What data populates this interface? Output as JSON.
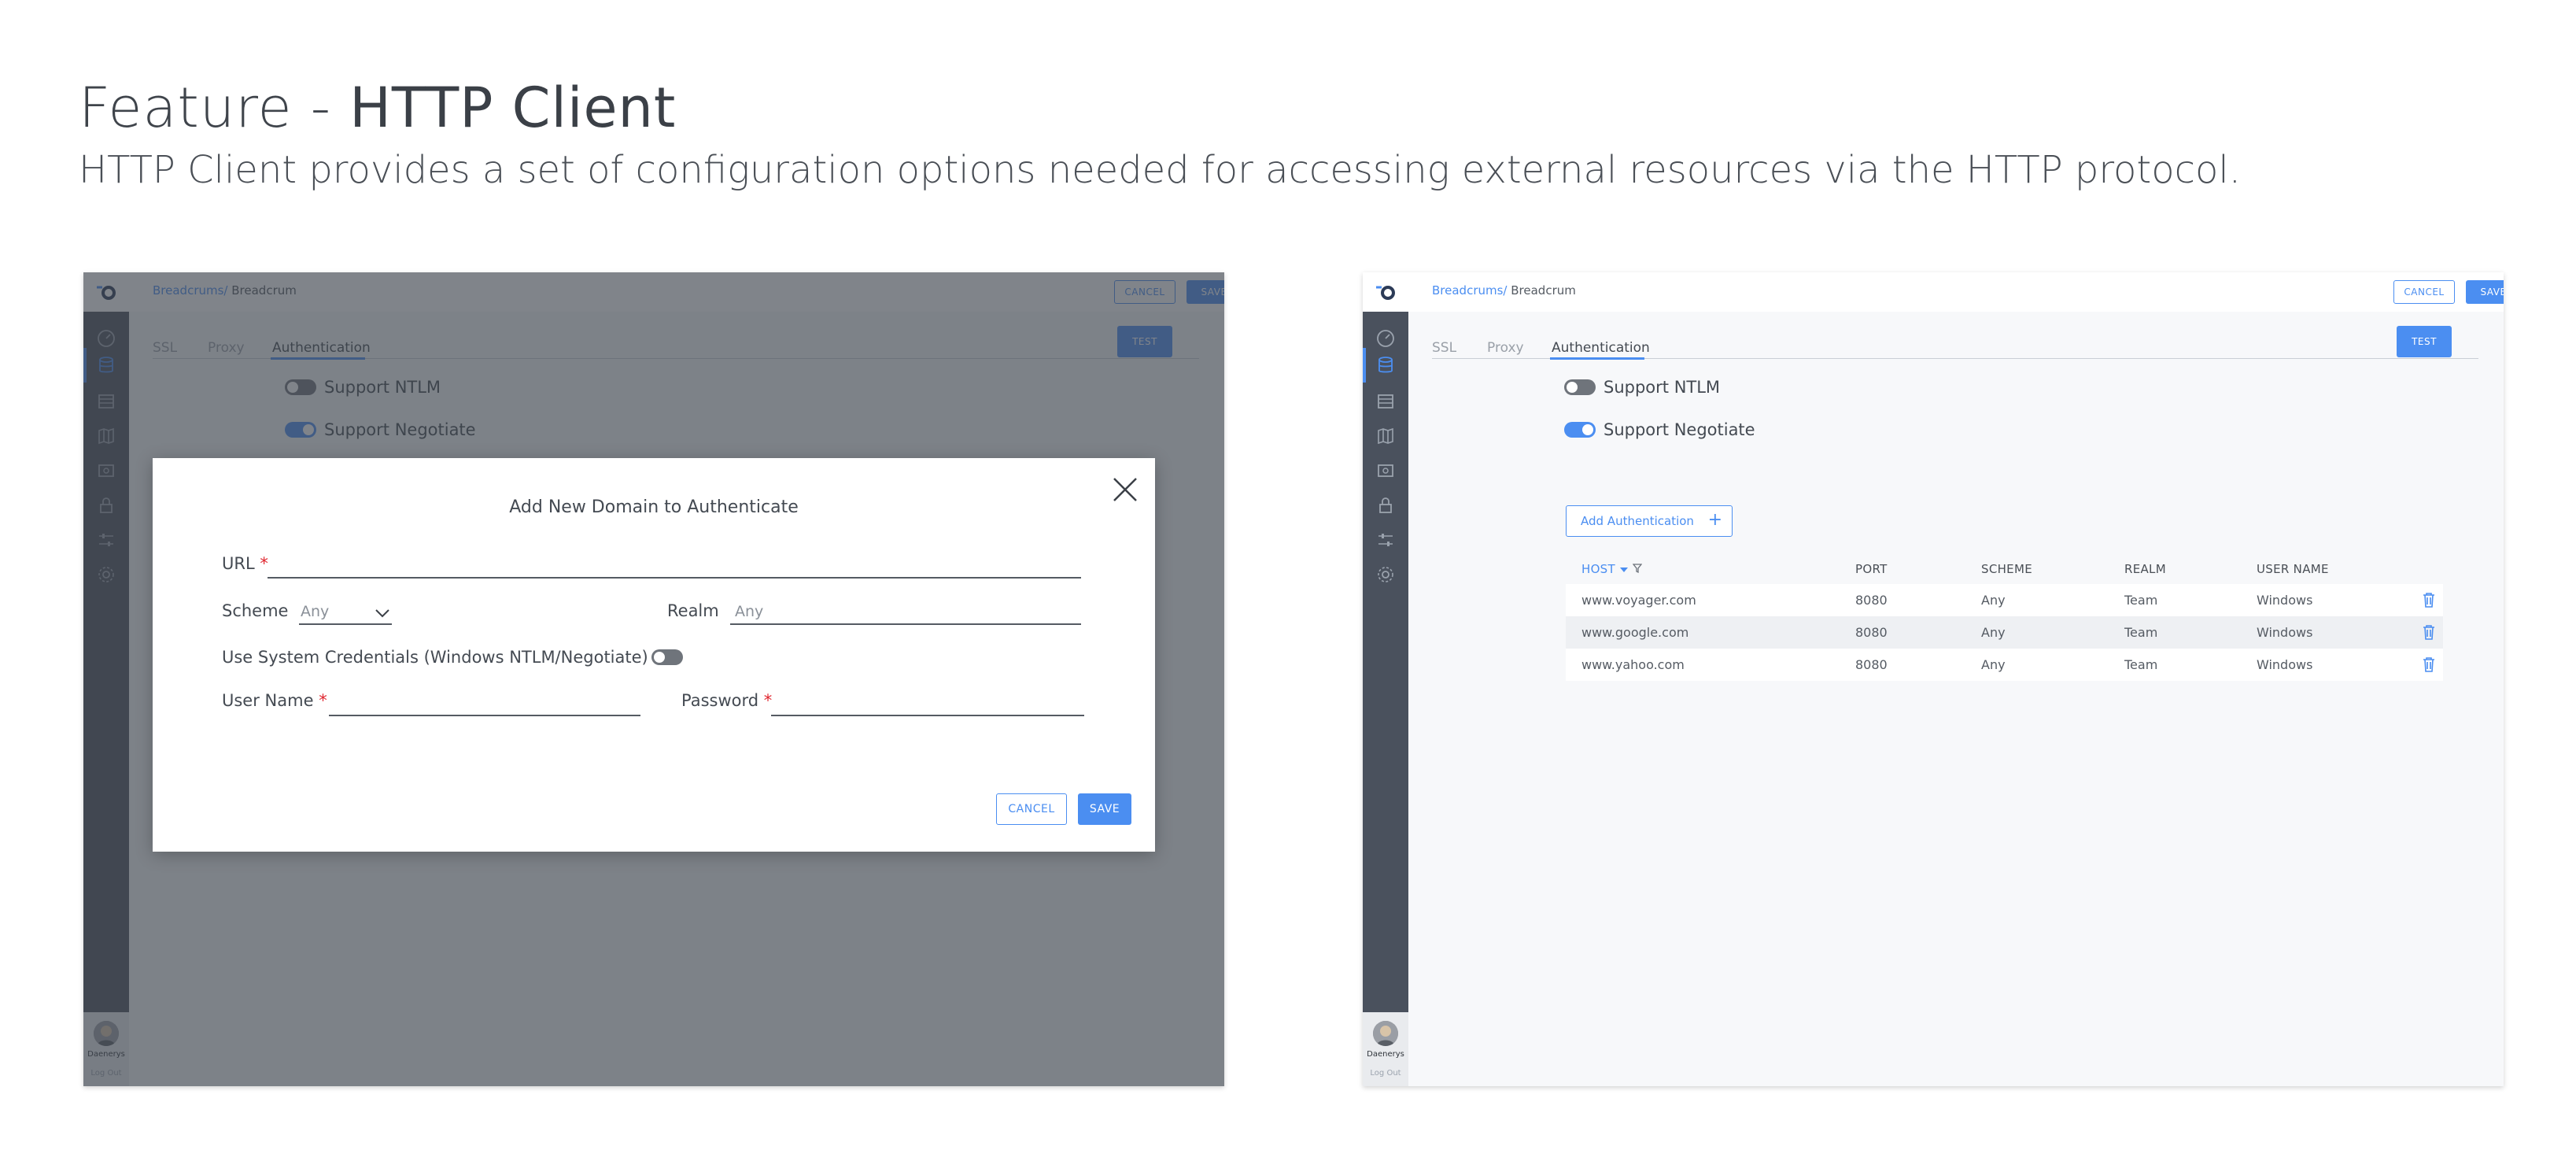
{
  "page": {
    "title_prefix": "Feature  - ",
    "title_main": "HTTP Client",
    "subtitle": "HTTP Client provides a set of configuration options needed for accessing external resources via the HTTP protocol."
  },
  "app": {
    "breadcrumb_link": "Breadcrums/",
    "breadcrumb_current": " Breadcrum",
    "cancel_label": "CANCEL",
    "save_label": "SAVE",
    "test_label": "TEST",
    "tabs": [
      {
        "label": "SSL",
        "active": false
      },
      {
        "label": "Proxy",
        "active": false
      },
      {
        "label": "Authentication",
        "active": true
      }
    ],
    "toggles": [
      {
        "label": "Support NTLM",
        "on": false
      },
      {
        "label": "Support Negotiate",
        "on": true
      }
    ],
    "user_name": "Daenerys",
    "logout_label": "Log Out",
    "sidebar_icons": [
      "gauge-icon",
      "database-icon",
      "list-icon",
      "map-icon",
      "card-icon",
      "lock-icon",
      "sliders-icon",
      "gear-icon"
    ],
    "accent_color": "#4b8ef1",
    "rail_color": "#4a515d"
  },
  "table": {
    "add_label": "Add Authentication",
    "columns": [
      "HOST",
      "PORT",
      "SCHEME",
      "REALM",
      "USER NAME"
    ],
    "rows": [
      {
        "host": "www.voyager.com",
        "port": "8080",
        "scheme": "Any",
        "realm": "Team",
        "user": "Windows"
      },
      {
        "host": "www.google.com",
        "port": "8080",
        "scheme": "Any",
        "realm": "Team",
        "user": "Windows"
      },
      {
        "host": "www.yahoo.com",
        "port": "8080",
        "scheme": "Any",
        "realm": "Team",
        "user": "Windows"
      }
    ]
  },
  "dialog": {
    "title": "Add New Domain to Authenticate",
    "url_label": "URL",
    "required_mark": "*",
    "scheme_label": "Scheme",
    "scheme_value": "Any",
    "realm_label": "Realm",
    "realm_placeholder": "Any",
    "system_credentials_label": "Use System Credentials (Windows NTLM/Negotiate)",
    "system_credentials_on": false,
    "username_label": "User Name",
    "password_label": "Password",
    "cancel_label": "CANCEL",
    "save_label": "SAVE"
  }
}
